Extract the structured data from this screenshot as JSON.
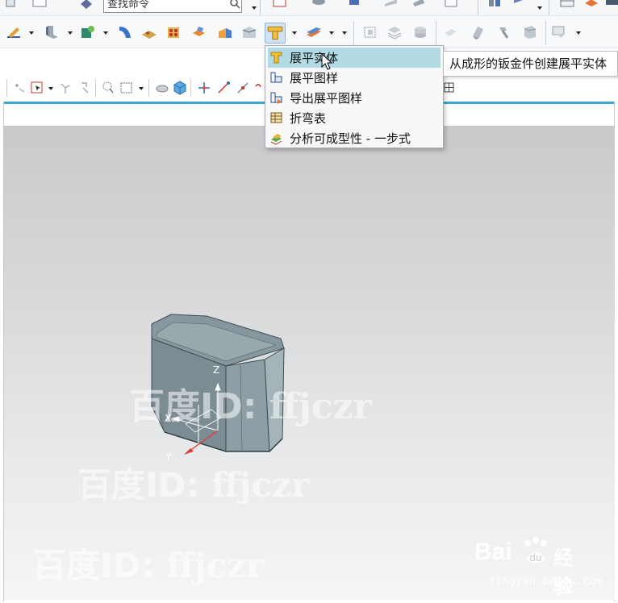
{
  "toolbar_top": {
    "command_finder_value": "查找命令"
  },
  "dropdown": {
    "items": [
      {
        "label": "展平实体",
        "icon": "flat-solid-icon"
      },
      {
        "label": "展平图样",
        "icon": "flat-pattern-icon"
      },
      {
        "label": "导出展平图样",
        "icon": "export-flat-pattern-icon"
      },
      {
        "label": "折弯表",
        "icon": "bend-table-icon"
      },
      {
        "label": "分析可成型性 - 一步式",
        "icon": "formability-analysis-icon"
      }
    ],
    "hovered_index": 0
  },
  "tooltip": {
    "text": "从成形的钣金件创建展平实体"
  },
  "triad": {
    "x_label": "X",
    "y_label": "Y",
    "z_label": "Z"
  },
  "watermarks": {
    "line1_cn": "百度ID:",
    "line1_id": "ffjczr",
    "line2_cn": "百度ID:",
    "line2_id": "ffjczr",
    "line3_cn": "百度ID:",
    "line3_id": "ffjczr"
  },
  "baidu": {
    "brand": "Bai",
    "brand2": "经验",
    "url": "jingyan.baidu.com"
  },
  "colors": {
    "accent": "#3aa6d8",
    "menu_hover": "#b2dae4",
    "model_face": "#7f9196"
  }
}
